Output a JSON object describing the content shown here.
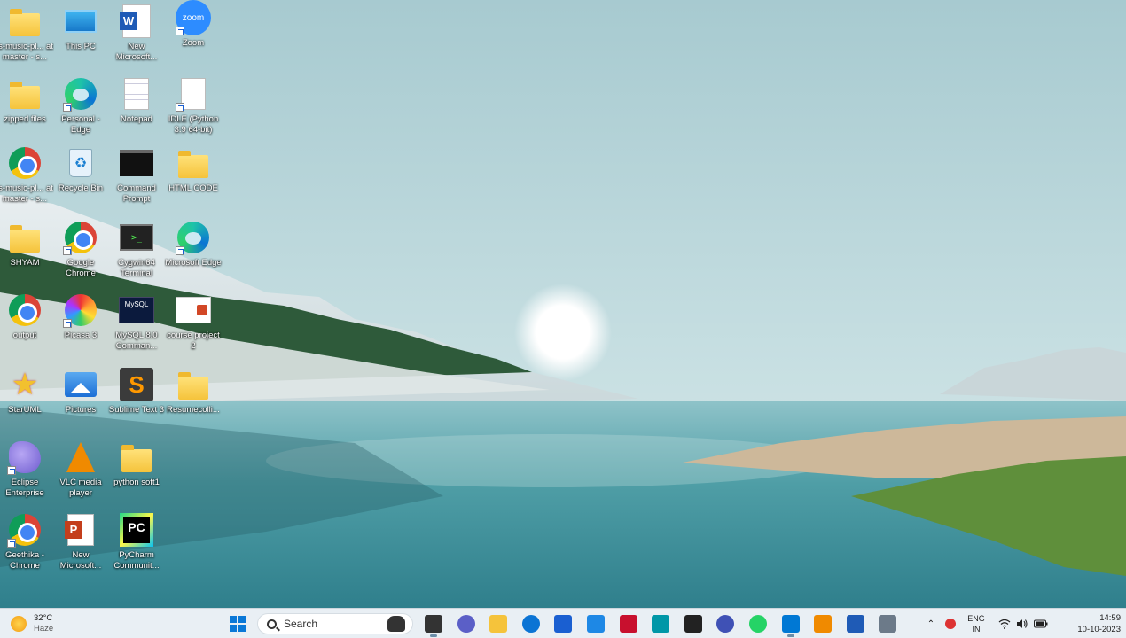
{
  "desktop": {
    "icons": [
      {
        "label": "js-music-pl... at master - s...",
        "icon": "folder-icon"
      },
      {
        "label": "This PC",
        "icon": "this-pc-icon"
      },
      {
        "label": "New Microsoft...",
        "icon": "word-document-icon"
      },
      {
        "label": "Zoom",
        "icon": "zoom-icon"
      },
      {
        "label": "zipped files",
        "icon": "folder-icon"
      },
      {
        "label": "Personal - Edge",
        "icon": "edge-icon"
      },
      {
        "label": "Notepad",
        "icon": "notepad-icon"
      },
      {
        "label": "IDLE (Python 3.9 64-bit)",
        "icon": "python-idle-icon"
      },
      {
        "label": "js-music-pl... at master - s...",
        "icon": "chrome-icon"
      },
      {
        "label": "Recycle Bin",
        "icon": "recycle-bin-icon"
      },
      {
        "label": "Command Prompt",
        "icon": "command-prompt-icon"
      },
      {
        "label": "HTML CODE",
        "icon": "folder-icon"
      },
      {
        "label": "SHYAM",
        "icon": "folder-icon"
      },
      {
        "label": "Google Chrome",
        "icon": "chrome-icon"
      },
      {
        "label": "Cygwin64 Terminal",
        "icon": "cygwin-icon"
      },
      {
        "label": "Microsoft Edge",
        "icon": "edge-icon"
      },
      {
        "label": "output",
        "icon": "chrome-icon"
      },
      {
        "label": "Picasa 3",
        "icon": "picasa-icon"
      },
      {
        "label": "MySQL 8.0 Comman...",
        "icon": "mysql-icon"
      },
      {
        "label": "course project 2",
        "icon": "presentation-file-icon"
      },
      {
        "label": "StarUML",
        "icon": "staruml-icon"
      },
      {
        "label": "Pictures",
        "icon": "pictures-icon"
      },
      {
        "label": "Sublime Text 3",
        "icon": "sublime-text-icon"
      },
      {
        "label": "Resumecolli...",
        "icon": "folder-icon"
      },
      {
        "label": "Eclipse Enterprise",
        "icon": "eclipse-icon"
      },
      {
        "label": "VLC media player",
        "icon": "vlc-icon"
      },
      {
        "label": "python soft1",
        "icon": "folder-icon"
      },
      {
        "label": "Geethika - Chrome",
        "icon": "chrome-icon"
      },
      {
        "label": "New Microsoft...",
        "icon": "powerpoint-icon"
      },
      {
        "label": "PyCharm Communit...",
        "icon": "pycharm-icon"
      }
    ]
  },
  "taskbar": {
    "weather": {
      "temp": "32°C",
      "condition": "Haze"
    },
    "search_label": "Search",
    "apps": [
      {
        "name": "task-view",
        "color": "#333333"
      },
      {
        "name": "chat",
        "color": "#5b5fc7"
      },
      {
        "name": "file-explorer",
        "color": "#f5c33b"
      },
      {
        "name": "edge",
        "color": "#0b74d4"
      },
      {
        "name": "microsoft-store",
        "color": "#1a5fd1"
      },
      {
        "name": "app-l",
        "color": "#1e88e5"
      },
      {
        "name": "mcafee",
        "color": "#c8102e"
      },
      {
        "name": "app-teal",
        "color": "#0097a7"
      },
      {
        "name": "app-dark",
        "color": "#222222"
      },
      {
        "name": "app-blue-circle",
        "color": "#3f51b5"
      },
      {
        "name": "whatsapp",
        "color": "#25d366"
      },
      {
        "name": "vscode",
        "color": "#0078d4"
      },
      {
        "name": "vlc",
        "color": "#f08a00"
      },
      {
        "name": "word",
        "color": "#1f5bb6"
      },
      {
        "name": "snipping-tool",
        "color": "#6c7a89"
      }
    ],
    "tray": {
      "lang_top": "ENG",
      "lang_bottom": "IN",
      "time": "14:59",
      "date": "10-10-2023"
    }
  }
}
